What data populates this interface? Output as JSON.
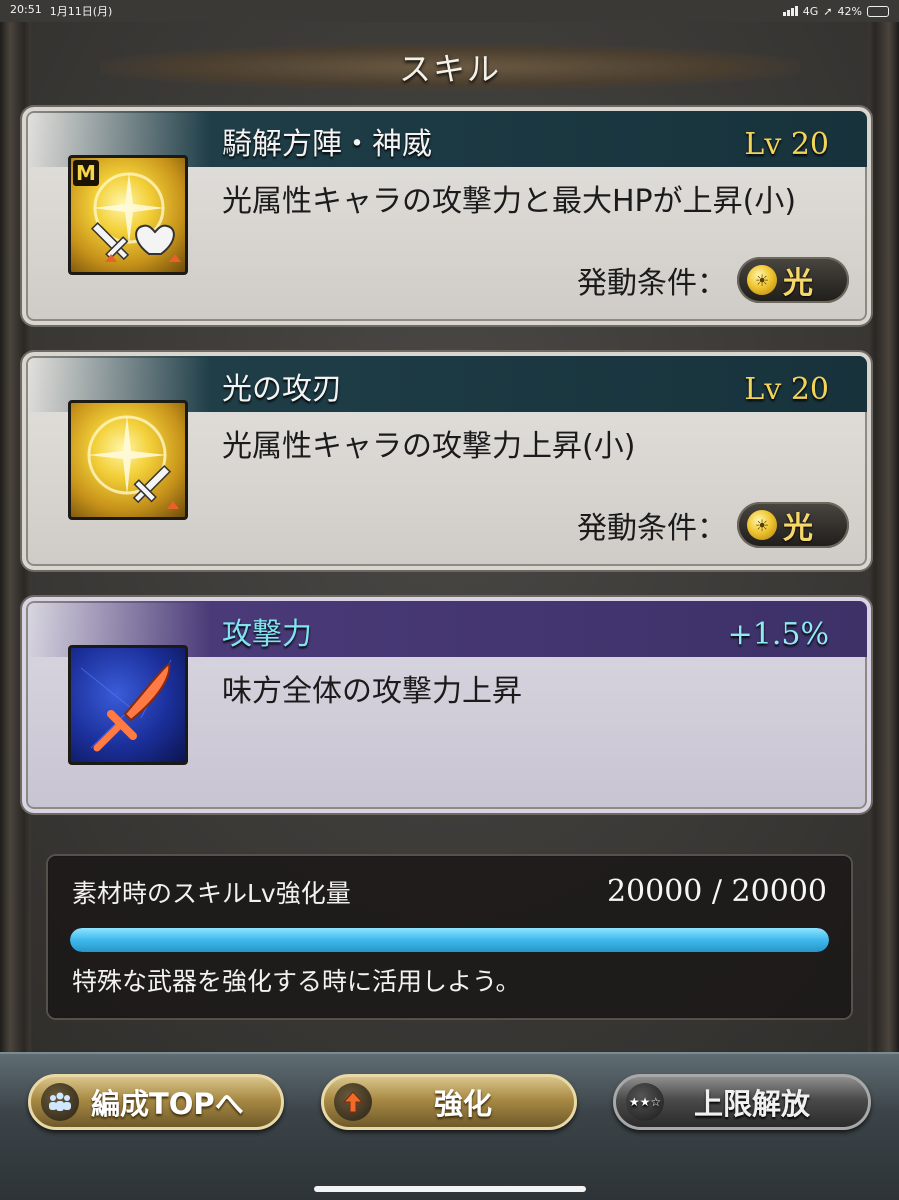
{
  "status_bar": {
    "time": "20:51",
    "date": "1月11日(月)",
    "network": "4G",
    "battery": "42%",
    "battery_level": 0.42
  },
  "page_title": "スキル",
  "skills": [
    {
      "name": "騎解方陣・神威",
      "level": "Lv 20",
      "description": "光属性キャラの攻撃力と最大HPが上昇(小)",
      "condition_label": "発動条件：",
      "condition_attr": "光",
      "icon": "sword-heart-light-icon",
      "badge": "M"
    },
    {
      "name": "光の攻刃",
      "level": "Lv 20",
      "description": "光属性キャラの攻撃力上昇(小)",
      "condition_label": "発動条件：",
      "condition_attr": "光",
      "icon": "sword-light-icon"
    },
    {
      "name": "攻撃力",
      "level": "+1.5%",
      "description": "味方全体の攻撃力上昇",
      "icon": "red-sword-icon"
    }
  ],
  "material": {
    "title": "素材時のスキルLv強化量",
    "value": "20000 / 20000",
    "progress": 1.0,
    "note": "特殊な武器を強化する時に活用しよう。"
  },
  "buttons": {
    "team_top": "編成TOPへ",
    "enhance": "強化",
    "limit_break": "上限解放",
    "limit_break_stars": "★★☆"
  },
  "colors": {
    "accent_gold": "#f3d45b",
    "accent_cyan": "#8feaf4",
    "progress_fill": "#3fb9ec"
  }
}
